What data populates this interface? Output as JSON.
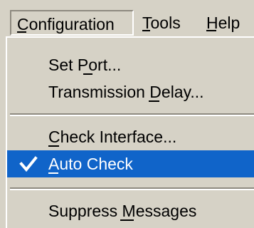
{
  "menubar": {
    "menus": [
      {
        "label": "Configuration"
      },
      {
        "label": "Tools"
      },
      {
        "label": "Help"
      }
    ]
  },
  "dropdown": {
    "items": [
      {
        "label": "Set Port..."
      },
      {
        "label": "Transmission Delay..."
      },
      {
        "label": "Check Interface..."
      },
      {
        "label": "Auto Check",
        "checked": true,
        "selected": true
      },
      {
        "label": "Suppress Messages"
      }
    ]
  },
  "colors": {
    "menu_background": "#d6d2c6",
    "selection": "#1064c9",
    "selection_text": "#ffffff"
  }
}
